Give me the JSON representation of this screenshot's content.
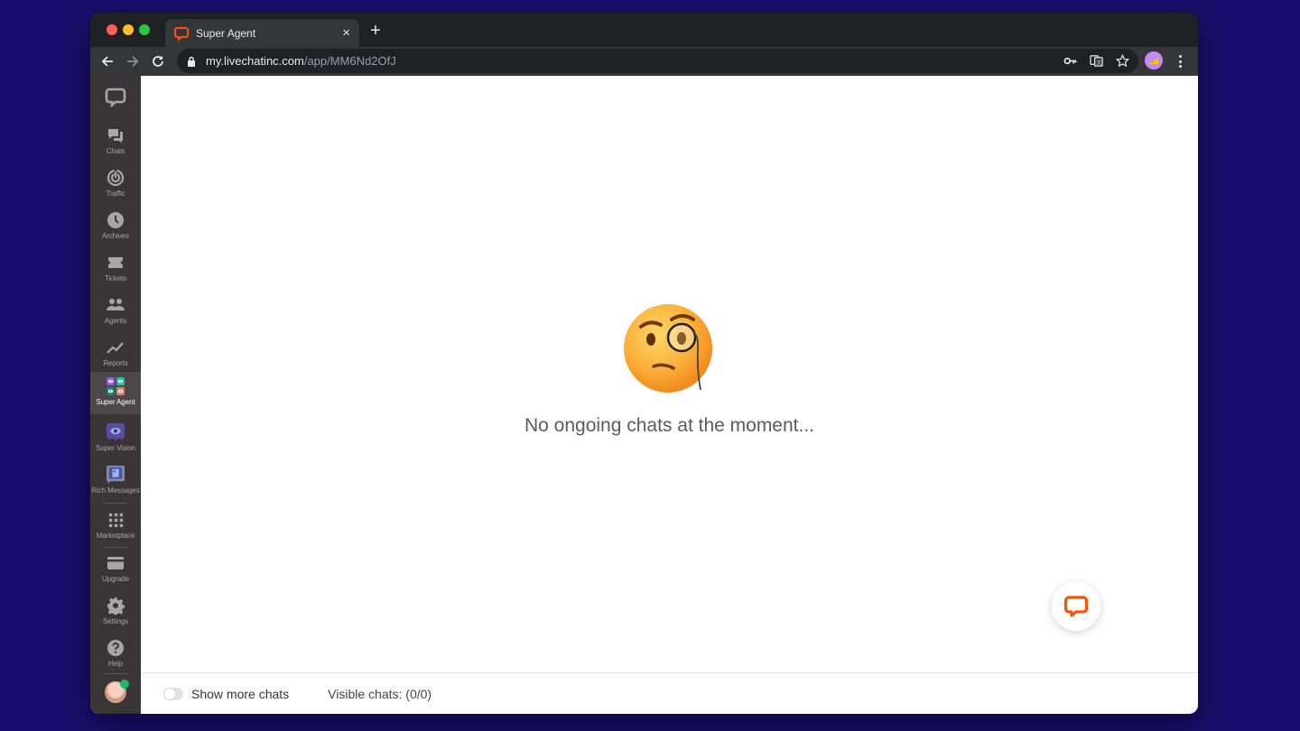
{
  "browser": {
    "tab": {
      "title": "Super Agent",
      "favicon": "livechat-logo-icon",
      "close": "×"
    },
    "new_tab": "+",
    "url": {
      "host": "my.livechatinc.com",
      "path": "/app/MM6Nd2OfJ"
    },
    "toolbar_icons": [
      "back-icon",
      "forward-icon",
      "reload-icon",
      "lock-icon",
      "key-icon",
      "translate-icon",
      "star-icon",
      "profile-avatar",
      "menu-icon"
    ]
  },
  "sidebar": {
    "items": [
      {
        "id": "chats",
        "label": "Chats",
        "icon": "chats-icon"
      },
      {
        "id": "traffic",
        "label": "Traffic",
        "icon": "traffic-icon"
      },
      {
        "id": "archives",
        "label": "Archives",
        "icon": "clock-icon"
      },
      {
        "id": "tickets",
        "label": "Tickets",
        "icon": "ticket-icon"
      },
      {
        "id": "agents",
        "label": "Agents",
        "icon": "agents-icon"
      },
      {
        "id": "reports",
        "label": "Reports",
        "icon": "chart-line-icon"
      },
      {
        "id": "super-agent",
        "label": "Super Agent",
        "icon": "super-agent-icon",
        "active": true
      },
      {
        "id": "super-vision",
        "label": "Super Vision",
        "icon": "eye-icon"
      },
      {
        "id": "rich-messages",
        "label": "Rich Messages",
        "icon": "rich-messages-icon"
      },
      {
        "id": "marketplace",
        "label": "Marketplace",
        "icon": "grid-icon"
      },
      {
        "id": "upgrade",
        "label": "Upgrade",
        "icon": "card-icon"
      },
      {
        "id": "settings",
        "label": "Settings",
        "icon": "gear-icon"
      },
      {
        "id": "help",
        "label": "Help",
        "icon": "help-icon"
      }
    ],
    "user_status": "online"
  },
  "main": {
    "empty_message": "No ongoing chats at the moment...",
    "emoji": "face-with-monocle"
  },
  "footer": {
    "toggle_label": "Show more chats",
    "toggle_on": false,
    "visible_chats": "Visible chats: (0/0)"
  },
  "colors": {
    "brand": "#ff5100",
    "sidebar_bg": "#3a3536",
    "desktop_bg": "#1a0f6e"
  }
}
